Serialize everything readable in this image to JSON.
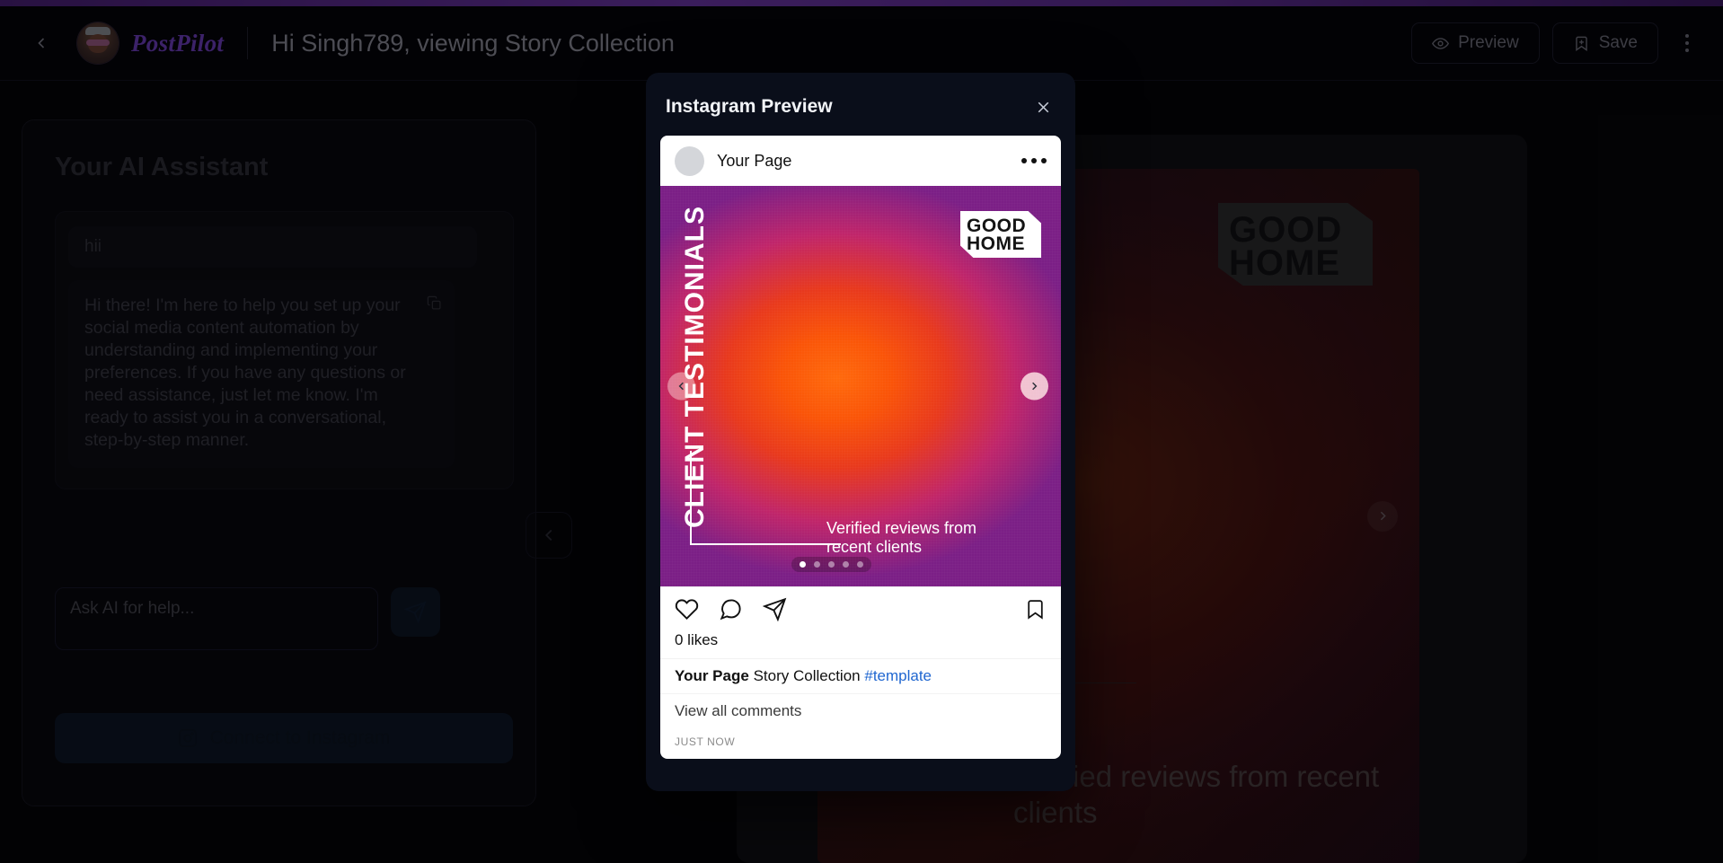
{
  "topbar": {
    "back_icon": "chevron-left-icon",
    "brand": "PostPilot",
    "title": "Hi Singh789, viewing Story Collection",
    "preview_label": "Preview",
    "preview_icon": "eye-icon",
    "save_label": "Save",
    "save_icon": "bookmark-plus-icon",
    "more_icon": "kebab-menu-icon"
  },
  "assistant": {
    "title": "Your AI Assistant",
    "messages": [
      {
        "role": "user",
        "text": "hii"
      },
      {
        "role": "assistant",
        "text": "Hi there! I'm here to help you set up your social media content automation by understanding and implementing your preferences. If you have any questions or need assistance, just let me know. I'm ready to assist you in a conversational, step-by-step manner."
      }
    ],
    "copy_icon": "copy-icon",
    "input_placeholder": "Ask AI for help...",
    "input_value": "",
    "send_icon": "send-icon",
    "connect_label": "Connect to Instagram",
    "connect_icon": "instagram-icon"
  },
  "canvas": {
    "prev_icon": "chevron-left-icon",
    "card": {
      "logo_line1": "GOOD",
      "logo_line2": "HOME",
      "caption": "Verified reviews from recent clients",
      "next_icon": "chevron-right-icon"
    }
  },
  "modal": {
    "title": "Instagram Preview",
    "close_icon": "close-icon",
    "post": {
      "username": "Your Page",
      "menu_icon": "more-dots-icon",
      "slide": {
        "vertical_text": "CLIENT TESTIMONIALS",
        "logo_line1": "GOOD",
        "logo_line2": "HOME",
        "caption": "Verified reviews from recent clients",
        "dot_count": 5,
        "active_dot": 1,
        "prev_icon": "chevron-left-icon",
        "next_icon": "chevron-right-icon"
      },
      "actions": {
        "like_icon": "heart-icon",
        "comment_icon": "comment-icon",
        "share_icon": "share-icon",
        "save_icon": "bookmark-icon"
      },
      "likes": "0 likes",
      "caption_author": "Your Page",
      "caption_text": "Story Collection",
      "caption_tag": "#template",
      "view_comments": "View all comments",
      "timestamp": "JUST NOW"
    }
  },
  "colors": {
    "accent_purple": "#6b35a8",
    "brand_purple": "#6e3fc0",
    "link_blue": "#1f66d0",
    "modal_bg": "#0a0e1a",
    "page_bg": "#050509"
  }
}
